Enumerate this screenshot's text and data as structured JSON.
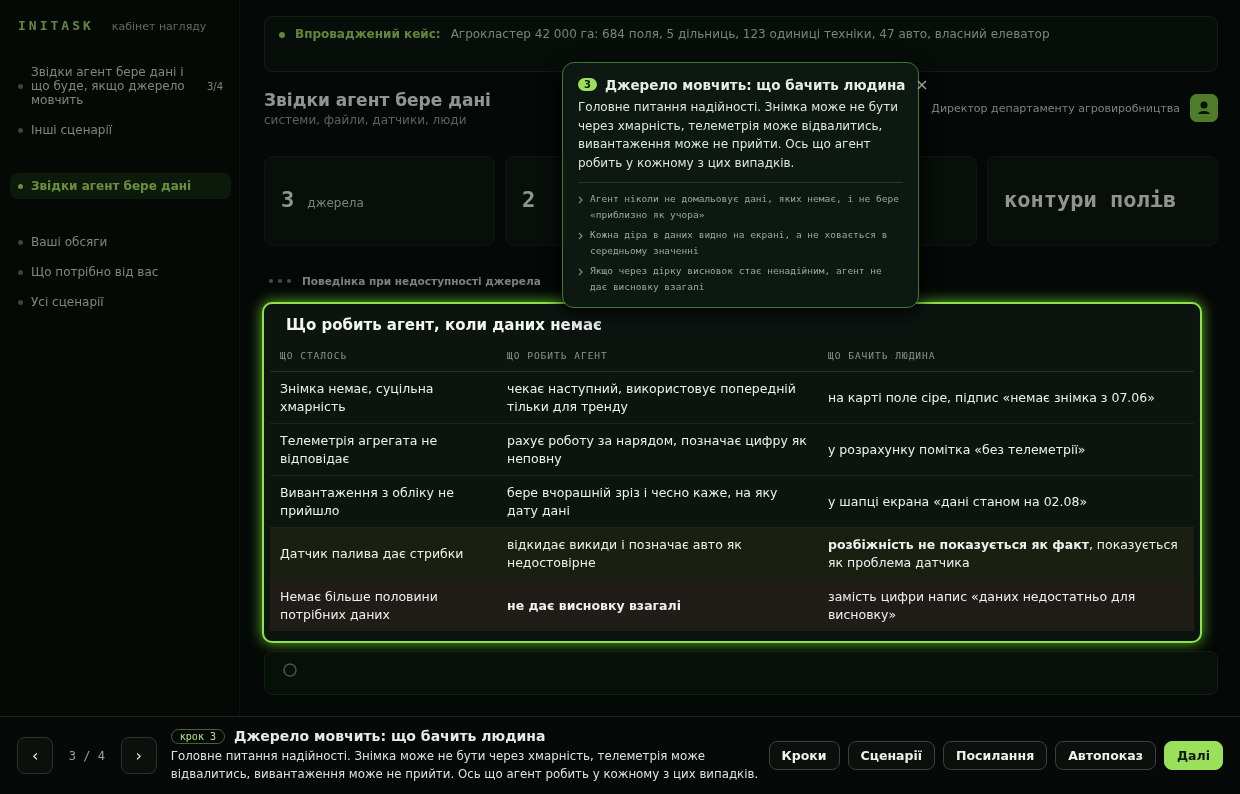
{
  "sidebar": {
    "brand": "INITASK",
    "brand_subtitle": "кабінет нагляду",
    "groups": [
      {
        "items": [
          {
            "label": "Звідки агент бере дані і що буде, якщо джерело мовчить",
            "count": "3/4",
            "selected": false
          },
          {
            "label": "Інші сценарії",
            "selected": false
          }
        ]
      },
      {
        "items": [
          {
            "label": "Звідки агент бере дані",
            "selected": true
          }
        ]
      },
      {
        "items": [
          {
            "label": "Ваші обсяги",
            "selected": false
          },
          {
            "label": "Що потрібно від вас",
            "selected": false
          },
          {
            "label": "Усі сценарії",
            "selected": false
          }
        ]
      }
    ]
  },
  "banner": {
    "label": "Впроваджений кейс:",
    "text": "Агрокластер 42 000 га: 684 поля, 5 дільниць, 123 одиниці техніки, 47 авто, власний елеватор"
  },
  "header": {
    "title": "Звідки агент бере дані",
    "subtitle": "системи, файли, датчики, люди",
    "role": "Директор департаменту агровиробництва"
  },
  "cards": [
    {
      "value": "3",
      "unit": "джерела"
    },
    {
      "value": "2"
    },
    {
      "value": "контури полів"
    }
  ],
  "step_line": {
    "text": "Поведінка при недоступності джерела"
  },
  "table": {
    "title": "Що робить агент, коли даних немає",
    "columns": [
      "ЩО СТАЛОСЬ",
      "ЩО РОБИТЬ АГЕНТ",
      "ЩО БАЧИТЬ ЛЮДИНА"
    ],
    "rows": [
      {
        "kind": "normal",
        "what": "Знімка немає, суцільна хмарність",
        "action": "чекає наступний, використовує попередній тільки для тренду",
        "action_bold": false,
        "seen": "на карті поле сіре, підпис «немає знімка з 07.06»"
      },
      {
        "kind": "normal",
        "what": "Телеметрія агрегата не відповідає",
        "action": "рахує роботу за нарядом, позначає цифру як неповну",
        "action_bold": false,
        "seen": "у розрахунку помітка «без телеметрії»"
      },
      {
        "kind": "normal",
        "what": "Вивантаження з обліку не прийшло",
        "action": "бере вчорашній зріз і чесно каже, на яку дату дані",
        "action_bold": false,
        "seen": "у шапці екрана «дані станом на 02.08»"
      },
      {
        "kind": "warn",
        "what": "Датчик палива дає стрибки",
        "action": "відкидає викиди і позначає авто як недостовірне",
        "action_bold": false,
        "seen": "**розбіжність не показується як факт**, показується як проблема датчика"
      },
      {
        "kind": "critical",
        "what": "Немає більше половини потрібних даних",
        "action": "не дає висновку взагалі",
        "action_bold": true,
        "seen": "замість цифри напис «даних недостатньо для висновку»"
      }
    ]
  },
  "popover": {
    "step": "3",
    "title": "Джерело мовчить: що бачить людина",
    "close": "×",
    "body": "Головне питання надійності. Знімка може не бути через хмарність, телеметрія може відвалитись, вивантаження може не прийти. Ось що агент робить у кожному з цих випадків.",
    "points": [
      "Агент ніколи не домальовує дані, яких немає, і не бере «приблизно як учора»",
      "Кожна діра в даних видно на екрані, а не ховається в середньому значенні",
      "Якщо через дірку висновок стає ненадійним, агент не дає висновку взагалі"
    ]
  },
  "footer": {
    "prev": "‹",
    "next": "›",
    "position": "3 / 4",
    "step_badge": "крок 3",
    "title": "Джерело мовчить: що бачить людина",
    "text": "Головне питання надійності. Знімка може не бути через хмарність, телеметрія може відвалитись, вивантаження може не прийти. Ось що агент робить у кожному з цих випадків.",
    "buttons": [
      {
        "label": "Кроки",
        "kind": "outline"
      },
      {
        "label": "Сценарії",
        "kind": "outline"
      },
      {
        "label": "Посилання",
        "kind": "outline"
      },
      {
        "label": "Автопоказ",
        "kind": "outline"
      },
      {
        "label": "Далі",
        "kind": "primary"
      }
    ]
  }
}
